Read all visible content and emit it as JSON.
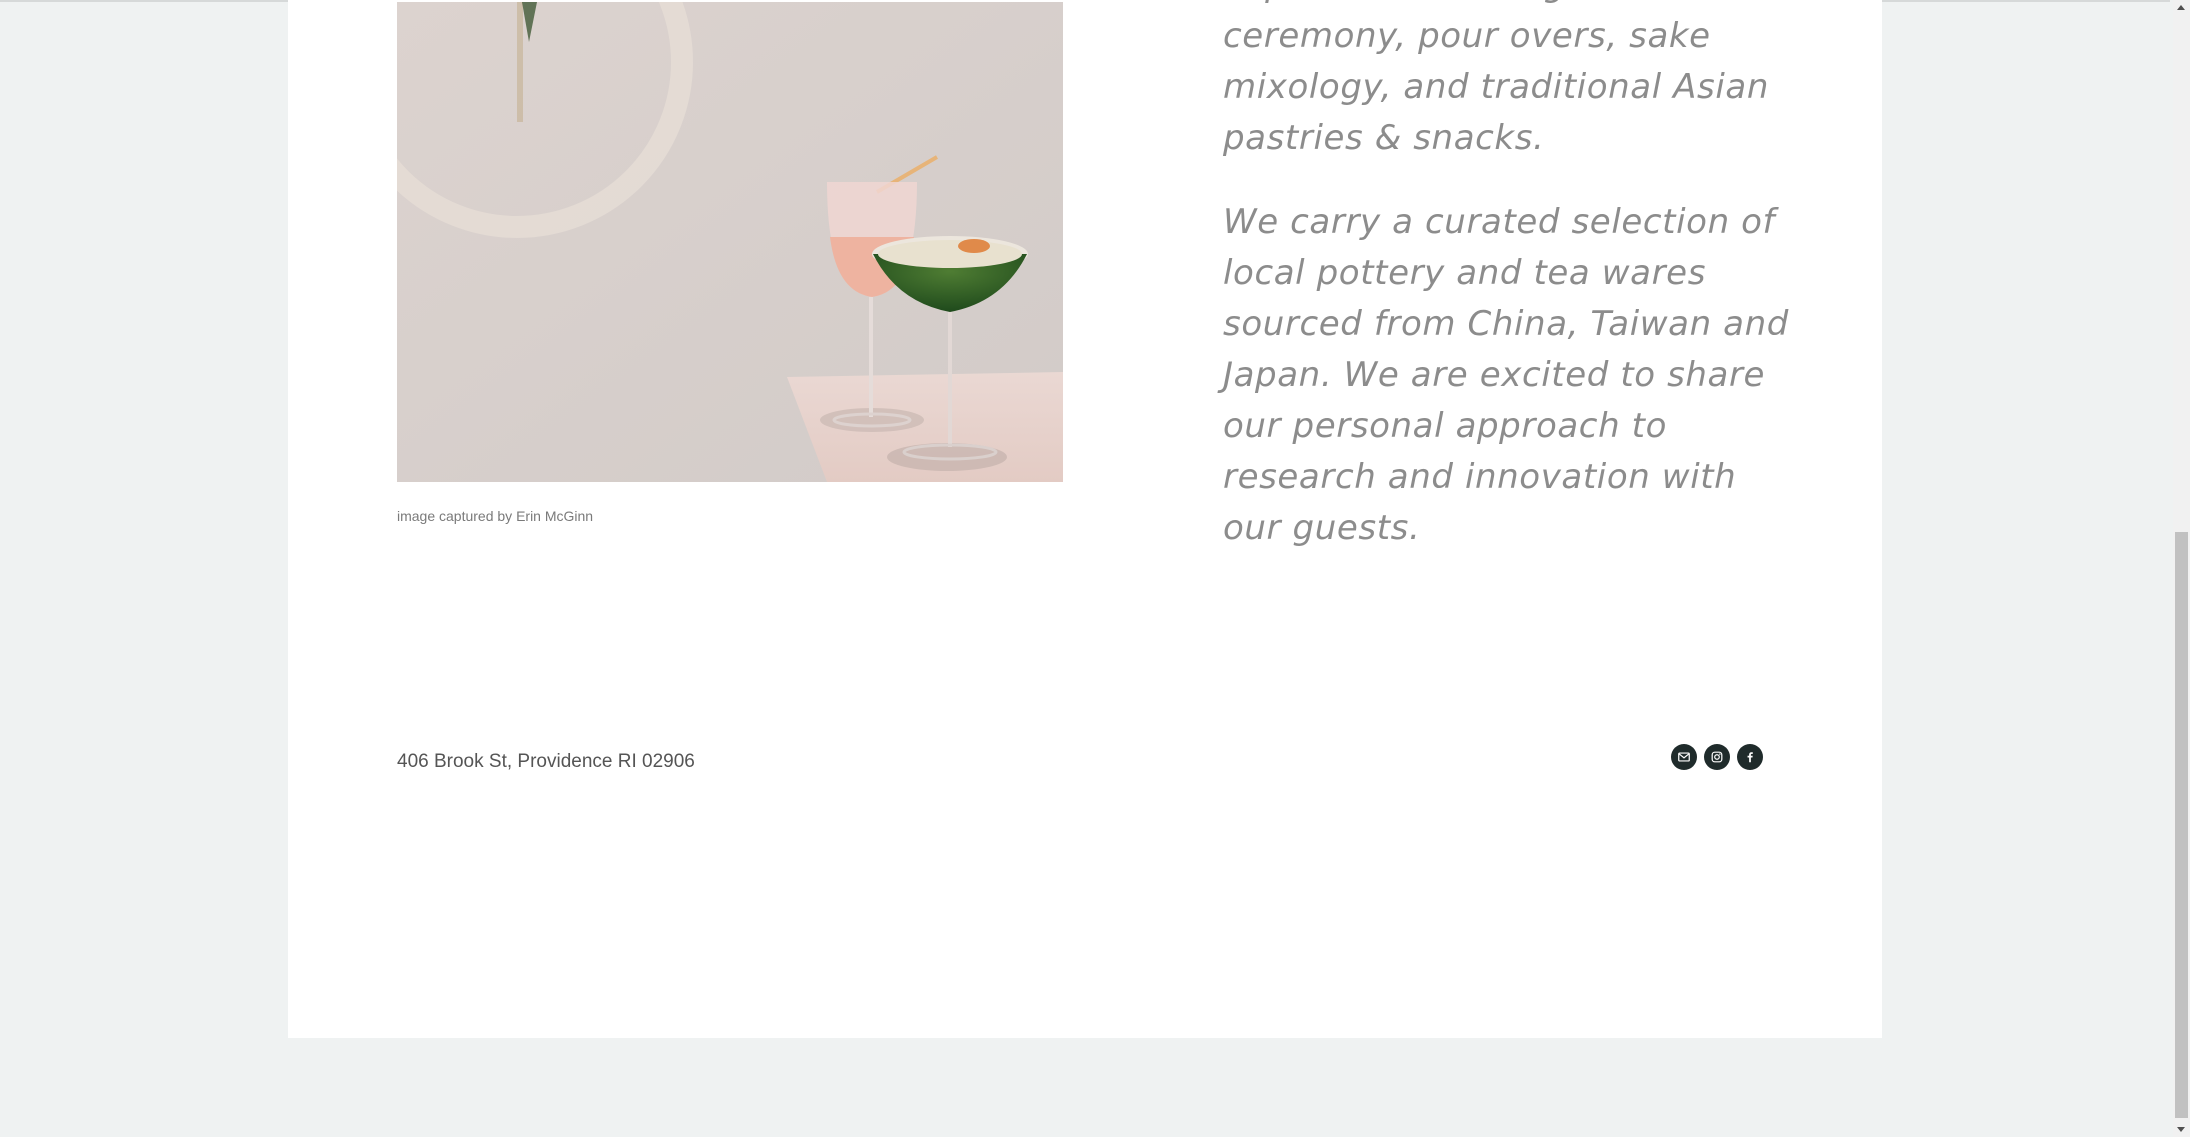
{
  "content": {
    "paragraph_1": "experiential tastings, tea ceremony, pour overs, sake mixology, and traditional Asian pastries & snacks.",
    "paragraph_2": "We carry a curated selection of local pottery and tea wares sourced from China, Taiwan and Japan. We are excited to share our personal approach to research and innovation with our guests."
  },
  "photo": {
    "caption": "image captured by Erin McGinn"
  },
  "footer": {
    "address": "406 Brook St, Providence RI 02906",
    "social": [
      {
        "icon": "mail-icon"
      },
      {
        "icon": "instagram-icon"
      },
      {
        "icon": "facebook-icon"
      }
    ]
  },
  "colors": {
    "page_background": "#eff2f2",
    "card_background": "#ffffff",
    "social_button": "#1f2b2b",
    "text_muted": "#8c8c8c"
  }
}
